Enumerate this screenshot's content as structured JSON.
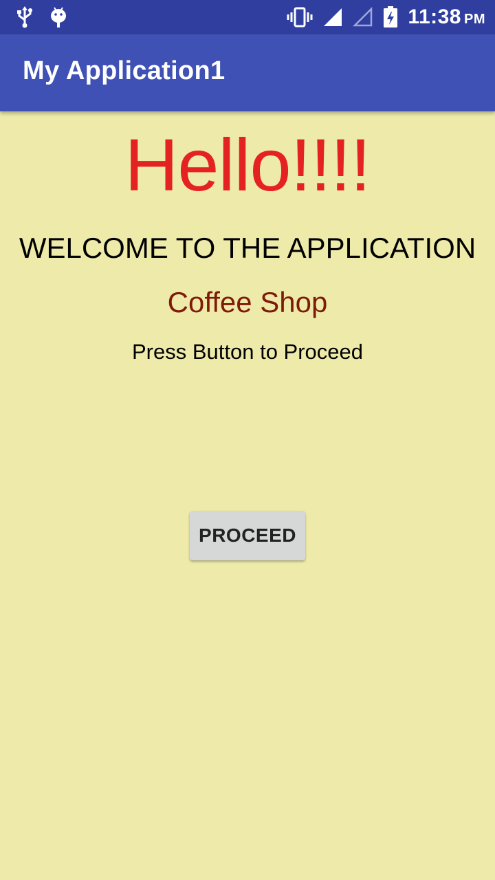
{
  "status_bar": {
    "left_icons": [
      "usb-icon",
      "android-debug-icon"
    ],
    "right_icons": [
      "vibrate-icon",
      "signal-icon",
      "signal-empty-icon",
      "battery-charging-icon"
    ],
    "time": "11:38",
    "ampm": "PM"
  },
  "app_bar": {
    "title": "My Application1",
    "color": "#3F51B5",
    "status_color": "#303F9F"
  },
  "main": {
    "background": "#EEEAAA",
    "greeting": "Hello!!!!",
    "greeting_color": "#E52222",
    "welcome": "WELCOME TO THE APPLICATION",
    "shop_name": "Coffee Shop",
    "shop_color": "#7F1A0A",
    "instruction": "Press Button to Proceed",
    "button_label": "PROCEED"
  }
}
